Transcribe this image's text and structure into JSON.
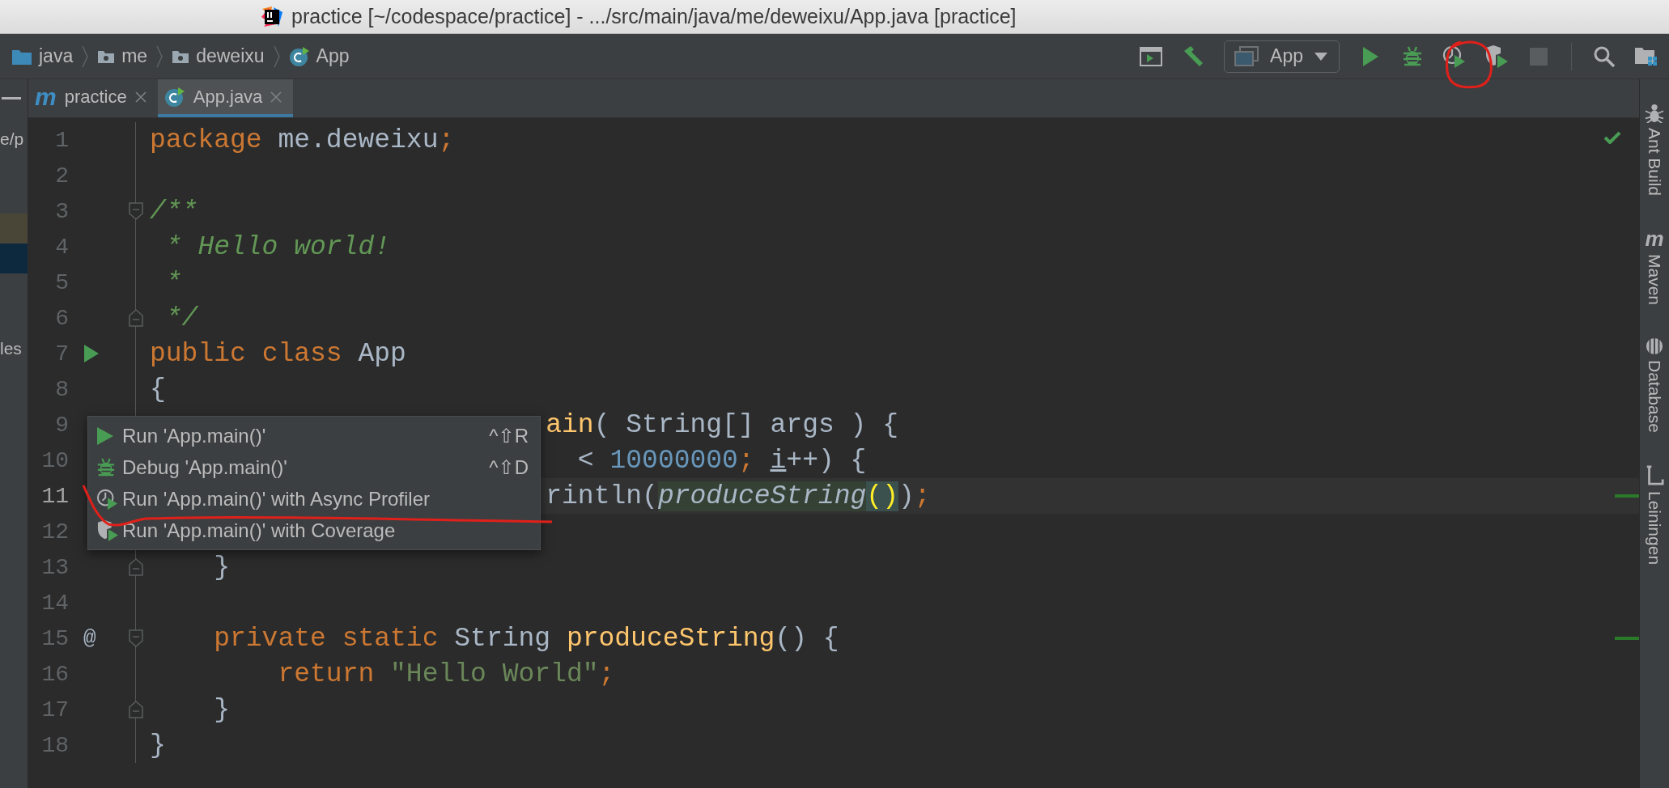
{
  "window": {
    "title": "practice [~/codespace/practice] - .../src/main/java/me/deweixu/App.java [practice]"
  },
  "breadcrumbs": [
    {
      "label": "java",
      "kind": "source-folder"
    },
    {
      "label": "me",
      "kind": "package"
    },
    {
      "label": "deweixu",
      "kind": "package"
    },
    {
      "label": "App",
      "kind": "class"
    }
  ],
  "toolbar": {
    "run_config": "App",
    "stop_disabled": true
  },
  "project_panel": {
    "rows": [
      {
        "kind": "label",
        "text": "e/p"
      },
      {
        "kind": "blank"
      },
      {
        "kind": "blank"
      },
      {
        "kind": "highlight"
      },
      {
        "kind": "selected"
      },
      {
        "kind": "blank"
      },
      {
        "kind": "blank"
      },
      {
        "kind": "label",
        "text": "les"
      }
    ]
  },
  "tabs": [
    {
      "label": "practice",
      "kind": "maven",
      "glyph": "m",
      "selected": false
    },
    {
      "label": "App.java",
      "kind": "class",
      "selected": true
    }
  ],
  "editor": {
    "lines": [
      {
        "number": "1",
        "current": false,
        "stripe": false,
        "covered": false,
        "run_icon": false,
        "fold_start": false,
        "fold_end": false,
        "tokens": [
          {
            "text": "package",
            "kind": "keyword"
          },
          {
            "text": " me.deweixu",
            "kind": "plain"
          },
          {
            "text": ";",
            "kind": "keyword"
          }
        ]
      },
      {
        "number": "2",
        "current": false,
        "stripe": false,
        "run_icon": false,
        "fold_start": false,
        "fold_end": false
      },
      {
        "number": "3",
        "current": false,
        "stripe": false,
        "covered": false,
        "run_icon": false,
        "fold_start": true,
        "fold_end": false,
        "tokens": [
          {
            "text": "/**",
            "kind": "doc"
          }
        ]
      },
      {
        "number": "4",
        "current": false,
        "stripe": false,
        "covered": false,
        "run_icon": false,
        "fold_start": false,
        "fold_end": false,
        "tokens": [
          {
            "text": " * Hello world!",
            "kind": "doc"
          }
        ]
      },
      {
        "number": "5",
        "current": false,
        "stripe": false,
        "covered": false,
        "run_icon": false,
        "fold_start": false,
        "fold_end": false,
        "tokens": [
          {
            "text": " *",
            "kind": "doc"
          }
        ]
      },
      {
        "number": "6",
        "current": false,
        "stripe": false,
        "covered": false,
        "run_icon": false,
        "fold_start": false,
        "fold_end": true,
        "tokens": [
          {
            "text": " */",
            "kind": "doc"
          }
        ]
      },
      {
        "number": "7",
        "current": false,
        "stripe": false,
        "covered": false,
        "run_icon": true,
        "fold_start": false,
        "fold_end": false,
        "tokens": [
          {
            "text": "public",
            "kind": "keyword"
          },
          {
            "text": " class",
            "kind": "keyword"
          },
          {
            "text": " App",
            "kind": "plain"
          }
        ]
      },
      {
        "number": "8",
        "current": false,
        "stripe": false,
        "covered": false,
        "run_icon": false,
        "fold_start": false,
        "fold_end": false,
        "tokens": [
          {
            "text": "{",
            "kind": "plain"
          }
        ]
      },
      {
        "number": "9",
        "current": false,
        "stripe": false,
        "covered": true,
        "run_icon": false,
        "fold_start": false,
        "fold_end": false,
        "tokens": [
          {
            "text": "ain",
            "kind": "declaration"
          },
          {
            "text": "( String[] args ) {",
            "kind": "plain"
          }
        ]
      },
      {
        "number": "10",
        "current": false,
        "stripe": false,
        "covered": true,
        "run_icon": false,
        "fold_start": false,
        "fold_end": false,
        "tokens": [
          {
            "text": "  < ",
            "kind": "plain"
          },
          {
            "text": "10000000",
            "kind": "number"
          },
          {
            "text": "; ",
            "kind": "keyword"
          },
          {
            "text": "i",
            "kind": "reassigned"
          },
          {
            "text": "++) {",
            "kind": "plain"
          }
        ]
      },
      {
        "number": "11",
        "current": true,
        "stripe": true,
        "covered": true,
        "run_icon": false,
        "fold_start": false,
        "fold_end": false,
        "tokens": [
          {
            "text": "rintln(",
            "kind": "plain"
          },
          {
            "text": "produceString",
            "kind": "usage"
          },
          {
            "text": "()",
            "kind": "brace-match"
          },
          {
            "text": ")",
            "kind": "plain"
          },
          {
            "text": ";",
            "kind": "keyword"
          }
        ]
      },
      {
        "number": "12",
        "current": false,
        "stripe": false,
        "run_icon": false,
        "fold_start": false,
        "fold_end": false
      },
      {
        "number": "13",
        "current": false,
        "stripe": false,
        "covered": false,
        "run_icon": false,
        "fold_start": false,
        "fold_end": true,
        "tokens": [
          {
            "text": "    }",
            "kind": "plain"
          }
        ]
      },
      {
        "number": "14",
        "current": false,
        "stripe": false,
        "run_icon": false,
        "fold_start": false,
        "fold_end": false
      },
      {
        "number": "15",
        "current": false,
        "stripe": true,
        "covered": false,
        "run_icon": false,
        "fold_start": true,
        "fold_end": false,
        "gutter_text": "@",
        "tokens": [
          {
            "text": "    private",
            "kind": "keyword"
          },
          {
            "text": " static",
            "kind": "keyword"
          },
          {
            "text": " String ",
            "kind": "plain"
          },
          {
            "text": "produceString",
            "kind": "declaration"
          },
          {
            "text": "() {",
            "kind": "plain"
          }
        ]
      },
      {
        "number": "16",
        "current": false,
        "stripe": false,
        "covered": false,
        "run_icon": false,
        "fold_start": false,
        "fold_end": false,
        "tokens": [
          {
            "text": "        return",
            "kind": "keyword"
          },
          {
            "text": " \"Hello World\"",
            "kind": "string"
          },
          {
            "text": ";",
            "kind": "keyword"
          }
        ]
      },
      {
        "number": "17",
        "current": false,
        "stripe": false,
        "covered": false,
        "run_icon": false,
        "fold_start": false,
        "fold_end": true,
        "tokens": [
          {
            "text": "    }",
            "kind": "plain"
          }
        ]
      },
      {
        "number": "18",
        "current": false,
        "stripe": false,
        "covered": false,
        "run_icon": false,
        "fold_start": false,
        "fold_end": false,
        "tokens": [
          {
            "text": "}",
            "kind": "plain"
          }
        ]
      }
    ]
  },
  "popup": {
    "items": [
      {
        "kind": "run",
        "label": "Run 'App.main()'",
        "shortcut": "^⇧R"
      },
      {
        "kind": "debug",
        "label": "Debug 'App.main()'",
        "shortcut": "^⇧D"
      },
      {
        "kind": "profiler",
        "label": "Run 'App.main()' with Async Profiler"
      },
      {
        "kind": "coverage",
        "label": "Run 'App.main()' with Coverage"
      }
    ]
  },
  "tool_windows": [
    {
      "label": "Ant Build",
      "kind": "ant"
    },
    {
      "label": "Maven",
      "kind": "maven",
      "glyph": "m"
    },
    {
      "label": "Database",
      "kind": "database"
    },
    {
      "label": "Leiningen",
      "kind": "leiningen"
    }
  ]
}
